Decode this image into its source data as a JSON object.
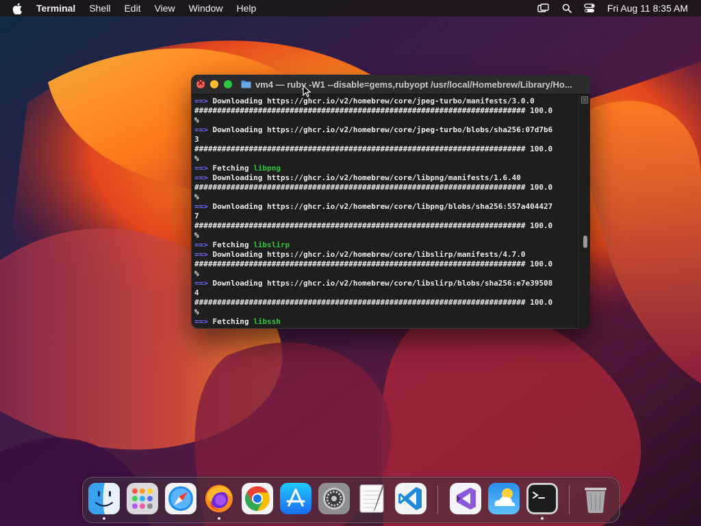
{
  "menubar": {
    "app_name": "Terminal",
    "menus": [
      "Shell",
      "Edit",
      "View",
      "Window",
      "Help"
    ],
    "icons": [
      "apple-icon",
      "screen-mirroring-icon",
      "spotlight-search-icon",
      "control-center-icon"
    ],
    "clock": "Fri Aug 11  8:35 AM"
  },
  "terminal": {
    "title": "vm4 — ruby -W1 --disable=gems,rubyopt /usr/local/Homebrew/Library/Ho...",
    "lines": [
      {
        "arrow": "==>",
        "text": " Downloading https://ghcr.io/v2/homebrew/core/jpeg-turbo/manifests/3.0.0"
      },
      {
        "text": "######################################################################### 100.0"
      },
      {
        "text": "%"
      },
      {
        "arrow": "==>",
        "text": " Downloading https://ghcr.io/v2/homebrew/core/jpeg-turbo/blobs/sha256:07d7b6"
      },
      {
        "text": "3"
      },
      {
        "text": "######################################################################### 100.0"
      },
      {
        "text": "%"
      },
      {
        "arrow": "==>",
        "text": " Fetching ",
        "pkg": "libpng"
      },
      {
        "arrow": "==>",
        "text": " Downloading https://ghcr.io/v2/homebrew/core/libpng/manifests/1.6.40"
      },
      {
        "text": "######################################################################### 100.0"
      },
      {
        "text": "%"
      },
      {
        "arrow": "==>",
        "text": " Downloading https://ghcr.io/v2/homebrew/core/libpng/blobs/sha256:557a404427"
      },
      {
        "text": "7"
      },
      {
        "text": "######################################################################### 100.0"
      },
      {
        "text": "%"
      },
      {
        "arrow": "==>",
        "text": " Fetching ",
        "pkg": "libslirp"
      },
      {
        "arrow": "==>",
        "text": " Downloading https://ghcr.io/v2/homebrew/core/libslirp/manifests/4.7.0"
      },
      {
        "text": "######################################################################### 100.0"
      },
      {
        "text": "%"
      },
      {
        "arrow": "==>",
        "text": " Downloading https://ghcr.io/v2/homebrew/core/libslirp/blobs/sha256:e7e39508"
      },
      {
        "text": "4"
      },
      {
        "text": "######################################################################### 100.0"
      },
      {
        "text": "%"
      },
      {
        "arrow": "==>",
        "text": " Fetching ",
        "pkg": "libssh"
      }
    ],
    "colors": {
      "arrow": "#6f6bff",
      "package": "#35c73a",
      "text": "#ececec"
    }
  },
  "dock": {
    "apps": [
      {
        "name": "Finder",
        "icon": "finder-icon",
        "running": true
      },
      {
        "name": "Launchpad",
        "icon": "launchpad-icon",
        "running": false
      },
      {
        "name": "Safari",
        "icon": "safari-icon",
        "running": false
      },
      {
        "name": "Firefox",
        "icon": "firefox-icon",
        "running": true
      },
      {
        "name": "Google Chrome",
        "icon": "chrome-icon",
        "running": false
      },
      {
        "name": "App Store",
        "icon": "app-store-icon",
        "running": false
      },
      {
        "name": "System Settings",
        "icon": "system-settings-icon",
        "running": false
      },
      {
        "name": "TextEdit",
        "icon": "textedit-icon",
        "running": false
      },
      {
        "name": "Visual Studio Code",
        "icon": "vscode-icon",
        "running": false
      },
      {
        "name": "Visual Studio",
        "icon": "visual-studio-icon",
        "running": false
      },
      {
        "name": "Weather",
        "icon": "weather-icon",
        "running": false
      },
      {
        "name": "Terminal",
        "icon": "terminal-icon",
        "running": true
      },
      {
        "name": "Trash",
        "icon": "trash-icon",
        "running": false
      }
    ]
  }
}
